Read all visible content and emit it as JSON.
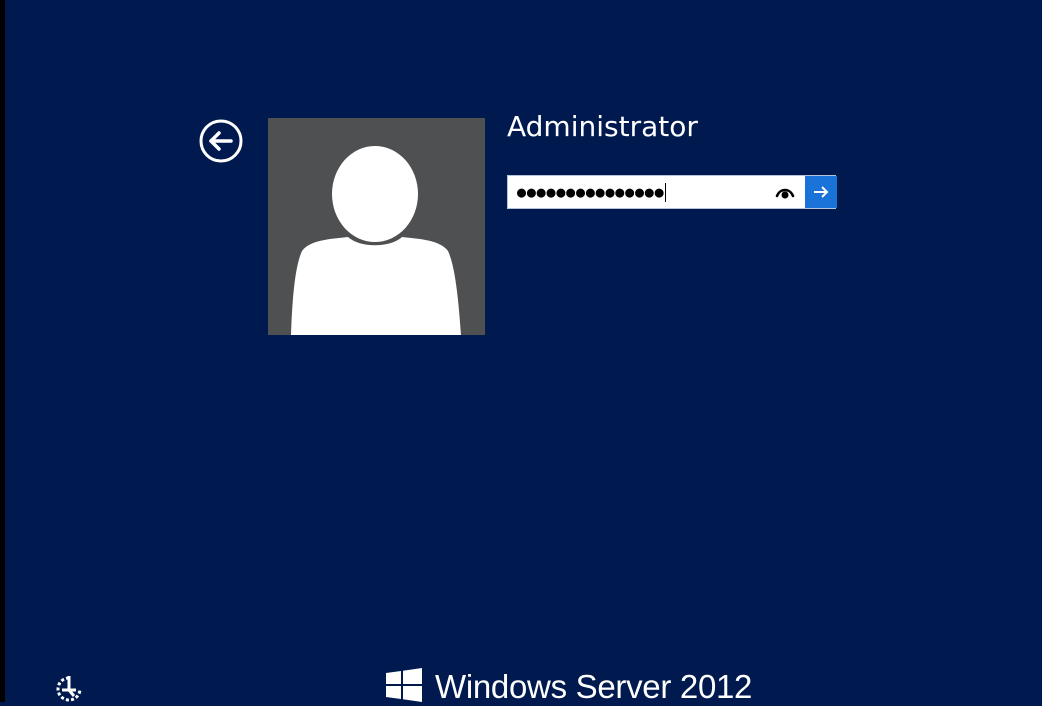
{
  "login": {
    "username": "Administrator",
    "password_masked": "●●●●●●●●●●●●●●●"
  },
  "branding": {
    "product_name": "Windows Server 2012"
  },
  "icons": {
    "back": "back-arrow-icon",
    "reveal": "eye-icon",
    "submit": "arrow-right-icon",
    "ease_of_access": "ease-of-access-icon",
    "logo": "windows-logo-icon"
  },
  "colors": {
    "background": "#001a4f",
    "avatar_bg": "#4f5051",
    "submit_button": "#1a73d9"
  }
}
